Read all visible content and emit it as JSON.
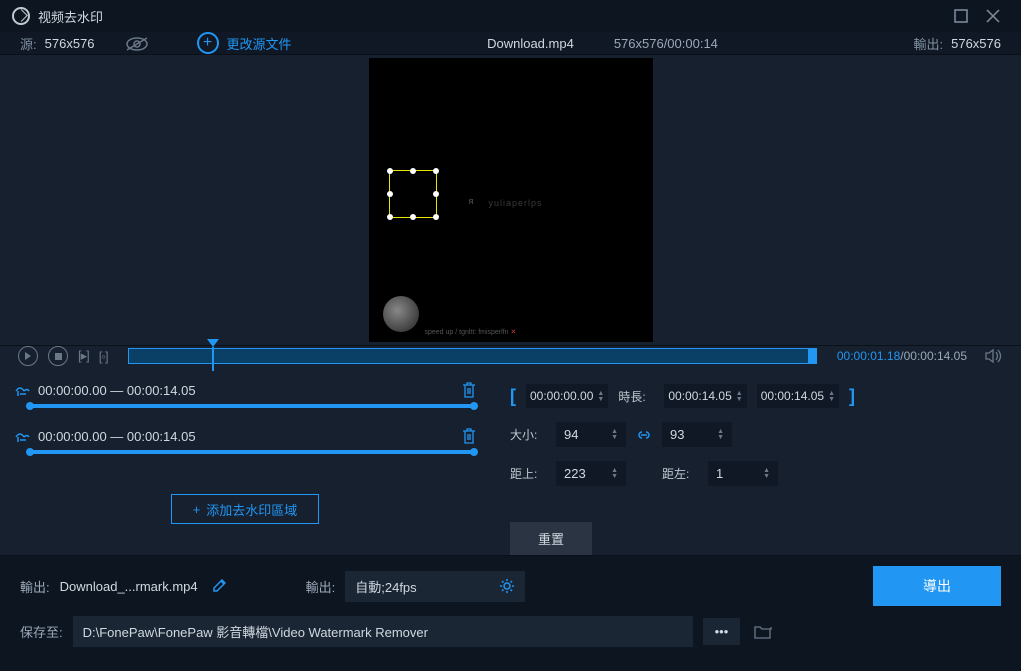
{
  "titlebar": {
    "title": "视频去水印"
  },
  "infobar": {
    "src_label": "源:",
    "src_value": "576x576",
    "change_src": "更改源文件",
    "filename": "Download.mp4",
    "dims_time": "576x576/00:00:14",
    "out_label": "輸出:",
    "out_value": "576x576"
  },
  "preview": {
    "watermark_text": "yuliaperlps",
    "credit_prefix": "speed up / tgnltt: fmisperlfn",
    "r_char": "я"
  },
  "playback": {
    "current": "00:00:01.18",
    "total": "00:00:14.05"
  },
  "segments": [
    {
      "range": "00:00:00.00 — 00:00:14.05"
    },
    {
      "range": "00:00:00.00 — 00:00:14.05"
    }
  ],
  "add_region_label": "添加去水印區域",
  "controls": {
    "start_time": "00:00:00.00",
    "duration_label": "時長:",
    "duration": "00:00:14.05",
    "end_time": "00:00:14.05",
    "size_label": "大小:",
    "width": "94",
    "height": "93",
    "top_label": "距上:",
    "top": "223",
    "left_label": "距左:",
    "left": "1",
    "reset": "重置"
  },
  "bottom": {
    "out_label": "輸出:",
    "out_file": "Download_...rmark.mp4",
    "out_label2": "輸出:",
    "format": "自動;24fps",
    "save_label": "保存至:",
    "save_path": "D:\\FonePaw\\FonePaw 影音轉檔\\Video Watermark Remover",
    "export": "導出"
  }
}
